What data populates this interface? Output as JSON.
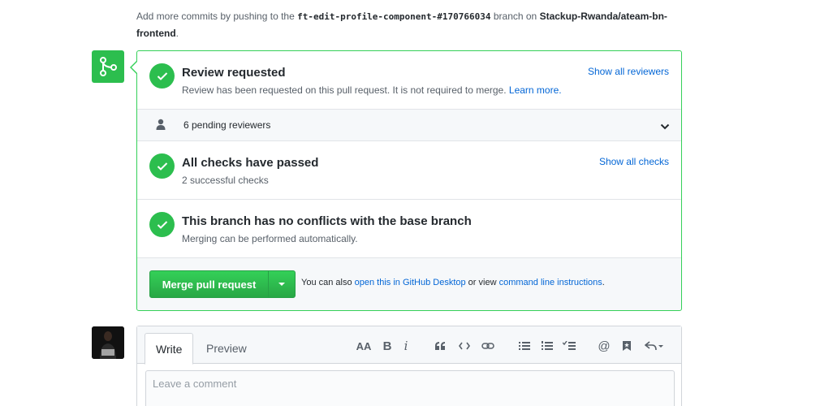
{
  "hint": {
    "prefix": "Add more commits by pushing to the ",
    "branch": "ft-edit-profile-component-#170766034",
    "middle": " branch on ",
    "repo": "Stackup-Rwanda/ateam-bn-frontend",
    "suffix": "."
  },
  "review": {
    "title": "Review requested",
    "subtitle": "Review has been requested on this pull request. It is not required to merge.",
    "learn_more": "Learn more.",
    "show_all": "Show all reviewers"
  },
  "reviewers": {
    "label": "6 pending reviewers"
  },
  "checks": {
    "title": "All checks have passed",
    "subtitle": "2 successful checks",
    "show_all": "Show all checks"
  },
  "conflicts": {
    "title": "This branch has no conflicts with the base branch",
    "subtitle": "Merging can be performed automatically."
  },
  "merge": {
    "button": "Merge pull request",
    "note_prefix": "You can also ",
    "desktop_link": "open this in GitHub Desktop",
    "note_middle": " or view ",
    "cli_link": "command line instructions",
    "note_suffix": "."
  },
  "comment": {
    "tab_write": "Write",
    "tab_preview": "Preview",
    "placeholder": "Leave a comment",
    "toolbar_text": "AA",
    "toolbar_bold": "B",
    "toolbar_italic": "i"
  },
  "colors": {
    "success": "#2cbe4e",
    "link": "#0366d6",
    "border_success": "#34d058"
  }
}
